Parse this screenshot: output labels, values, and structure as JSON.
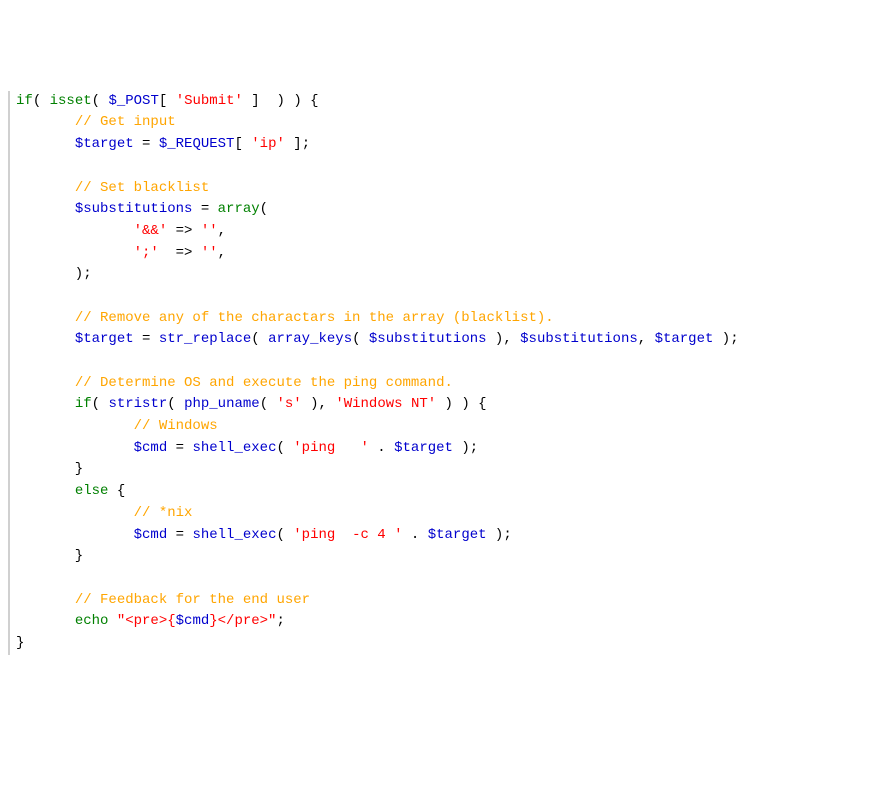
{
  "code": {
    "tokens": [
      {
        "t": "if",
        "c": "kw"
      },
      {
        "t": "( ",
        "c": "plain"
      },
      {
        "t": "isset",
        "c": "kw"
      },
      {
        "t": "( ",
        "c": "plain"
      },
      {
        "t": "$_POST",
        "c": "var"
      },
      {
        "t": "[ ",
        "c": "plain"
      },
      {
        "t": "'Submit'",
        "c": "str"
      },
      {
        "t": " ]  ) ) {",
        "c": "plain"
      },
      {
        "nl": true
      },
      {
        "t": "       ",
        "c": "plain"
      },
      {
        "t": "// Get input",
        "c": "cmt"
      },
      {
        "nl": true
      },
      {
        "t": "       ",
        "c": "plain"
      },
      {
        "t": "$target",
        "c": "var"
      },
      {
        "t": " = ",
        "c": "plain"
      },
      {
        "t": "$_REQUEST",
        "c": "var"
      },
      {
        "t": "[ ",
        "c": "plain"
      },
      {
        "t": "'ip'",
        "c": "str"
      },
      {
        "t": " ];",
        "c": "plain"
      },
      {
        "nl": true
      },
      {
        "nl": true
      },
      {
        "t": "       ",
        "c": "plain"
      },
      {
        "t": "// Set blacklist",
        "c": "cmt"
      },
      {
        "nl": true
      },
      {
        "t": "       ",
        "c": "plain"
      },
      {
        "t": "$substitutions",
        "c": "var"
      },
      {
        "t": " = ",
        "c": "plain"
      },
      {
        "t": "array",
        "c": "arr"
      },
      {
        "t": "(",
        "c": "plain"
      },
      {
        "nl": true
      },
      {
        "t": "              ",
        "c": "plain"
      },
      {
        "t": "'&&'",
        "c": "str"
      },
      {
        "t": " => ",
        "c": "plain"
      },
      {
        "t": "''",
        "c": "str"
      },
      {
        "t": ",",
        "c": "plain"
      },
      {
        "nl": true
      },
      {
        "t": "              ",
        "c": "plain"
      },
      {
        "t": "';'",
        "c": "str"
      },
      {
        "t": "  => ",
        "c": "plain"
      },
      {
        "t": "''",
        "c": "str"
      },
      {
        "t": ",",
        "c": "plain"
      },
      {
        "nl": true
      },
      {
        "t": "       );",
        "c": "plain"
      },
      {
        "nl": true
      },
      {
        "nl": true
      },
      {
        "t": "       ",
        "c": "plain"
      },
      {
        "t": "// Remove any of the charactars in the array (blacklist).",
        "c": "cmt"
      },
      {
        "nl": true
      },
      {
        "t": "       ",
        "c": "plain"
      },
      {
        "t": "$target",
        "c": "var"
      },
      {
        "t": " = ",
        "c": "plain"
      },
      {
        "t": "str_replace",
        "c": "fn"
      },
      {
        "t": "( ",
        "c": "plain"
      },
      {
        "t": "array_keys",
        "c": "fn"
      },
      {
        "t": "( ",
        "c": "plain"
      },
      {
        "t": "$substitutions",
        "c": "var"
      },
      {
        "t": " ), ",
        "c": "plain"
      },
      {
        "t": "$substitutions",
        "c": "var"
      },
      {
        "t": ", ",
        "c": "plain"
      },
      {
        "t": "$target",
        "c": "var"
      },
      {
        "t": " );",
        "c": "plain"
      },
      {
        "nl": true
      },
      {
        "nl": true
      },
      {
        "t": "       ",
        "c": "plain"
      },
      {
        "t": "// Determine OS and execute the ping command.",
        "c": "cmt"
      },
      {
        "nl": true
      },
      {
        "t": "       ",
        "c": "plain"
      },
      {
        "t": "if",
        "c": "kw"
      },
      {
        "t": "( ",
        "c": "plain"
      },
      {
        "t": "stristr",
        "c": "fn"
      },
      {
        "t": "( ",
        "c": "plain"
      },
      {
        "t": "php_uname",
        "c": "fn"
      },
      {
        "t": "( ",
        "c": "plain"
      },
      {
        "t": "'s'",
        "c": "str"
      },
      {
        "t": " ), ",
        "c": "plain"
      },
      {
        "t": "'Windows NT'",
        "c": "str"
      },
      {
        "t": " ) ) {",
        "c": "plain"
      },
      {
        "nl": true
      },
      {
        "t": "              ",
        "c": "plain"
      },
      {
        "t": "// Windows",
        "c": "cmt"
      },
      {
        "nl": true
      },
      {
        "t": "              ",
        "c": "plain"
      },
      {
        "t": "$cmd",
        "c": "var"
      },
      {
        "t": " = ",
        "c": "plain"
      },
      {
        "t": "shell_exec",
        "c": "fn"
      },
      {
        "t": "( ",
        "c": "plain"
      },
      {
        "t": "'ping   '",
        "c": "str"
      },
      {
        "t": " . ",
        "c": "plain"
      },
      {
        "t": "$target",
        "c": "var"
      },
      {
        "t": " );",
        "c": "plain"
      },
      {
        "nl": true
      },
      {
        "t": "       }",
        "c": "plain"
      },
      {
        "nl": true
      },
      {
        "t": "       ",
        "c": "plain"
      },
      {
        "t": "else",
        "c": "kw"
      },
      {
        "t": " {",
        "c": "plain"
      },
      {
        "nl": true
      },
      {
        "t": "              ",
        "c": "plain"
      },
      {
        "t": "// *nix",
        "c": "cmt"
      },
      {
        "nl": true
      },
      {
        "t": "              ",
        "c": "plain"
      },
      {
        "t": "$cmd",
        "c": "var"
      },
      {
        "t": " = ",
        "c": "plain"
      },
      {
        "t": "shell_exec",
        "c": "fn"
      },
      {
        "t": "( ",
        "c": "plain"
      },
      {
        "t": "'ping  -c 4 '",
        "c": "str"
      },
      {
        "t": " . ",
        "c": "plain"
      },
      {
        "t": "$target",
        "c": "var"
      },
      {
        "t": " );",
        "c": "plain"
      },
      {
        "nl": true
      },
      {
        "t": "       }",
        "c": "plain"
      },
      {
        "nl": true
      },
      {
        "nl": true
      },
      {
        "t": "       ",
        "c": "plain"
      },
      {
        "t": "// Feedback for the end user",
        "c": "cmt"
      },
      {
        "nl": true
      },
      {
        "t": "       ",
        "c": "plain"
      },
      {
        "t": "echo",
        "c": "echo"
      },
      {
        "t": " ",
        "c": "plain"
      },
      {
        "t": "\"<pre>{",
        "c": "str"
      },
      {
        "t": "$cmd",
        "c": "var"
      },
      {
        "t": "}</pre>\"",
        "c": "str"
      },
      {
        "t": ";",
        "c": "plain"
      },
      {
        "nl": true
      },
      {
        "t": "}",
        "c": "plain"
      }
    ]
  }
}
